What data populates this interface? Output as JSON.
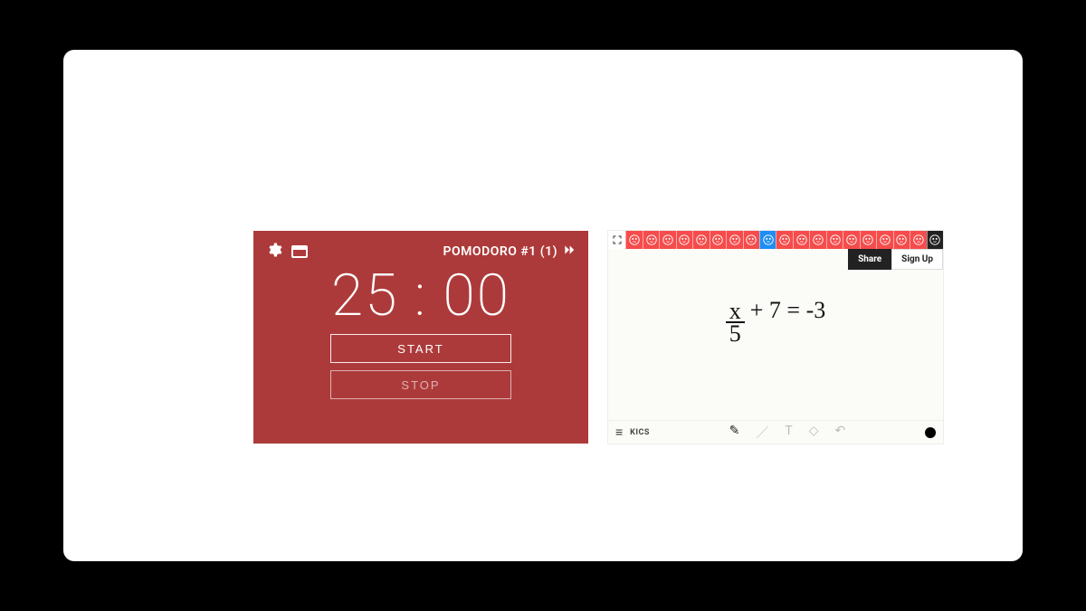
{
  "pomodoro": {
    "title": "POMODORO #1 (1)",
    "time": "25 : 00",
    "start_label": "START",
    "stop_label": "STOP"
  },
  "whiteboard": {
    "share_label": "Share",
    "signup_label": "Sign Up",
    "user_name": "KICS",
    "equation": {
      "numerator": "x",
      "denominator": "5",
      "rest": "+ 7 = -3"
    },
    "avatar_count": 19,
    "avatar_highlight_index": 8,
    "avatar_dark_index": 18
  }
}
